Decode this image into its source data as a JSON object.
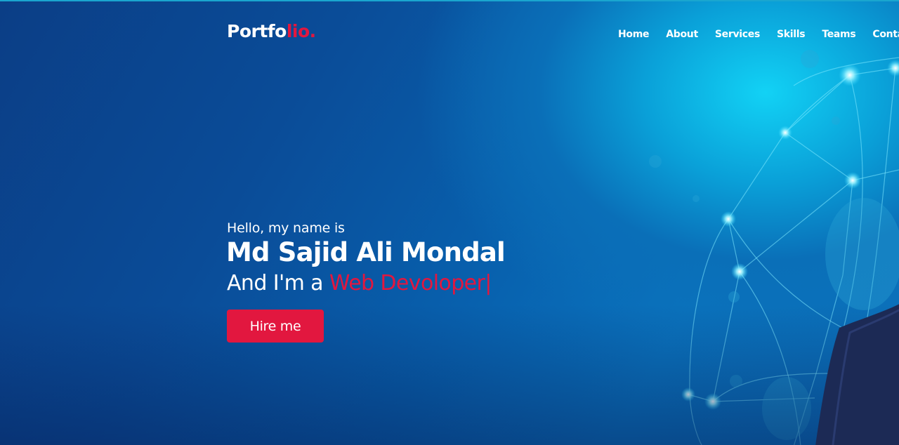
{
  "brand": {
    "logo_main": "Portfo",
    "logo_accent": "lio."
  },
  "nav": {
    "items": [
      {
        "label": "Home"
      },
      {
        "label": "About"
      },
      {
        "label": "Services"
      },
      {
        "label": "Skills"
      },
      {
        "label": "Teams"
      },
      {
        "label": "Contact"
      }
    ]
  },
  "hero": {
    "greeting": "Hello, my name is",
    "name": "Md Sajid Ali Mondal",
    "role_prefix": "And I'm a ",
    "role_typed": "Web Devoloper",
    "cursor": "|",
    "cta_label": "Hire me"
  },
  "colors": {
    "accent": "#e2173f",
    "background_dark": "#0b3e86",
    "background_glow": "#12d2f5",
    "text": "#ffffff"
  }
}
